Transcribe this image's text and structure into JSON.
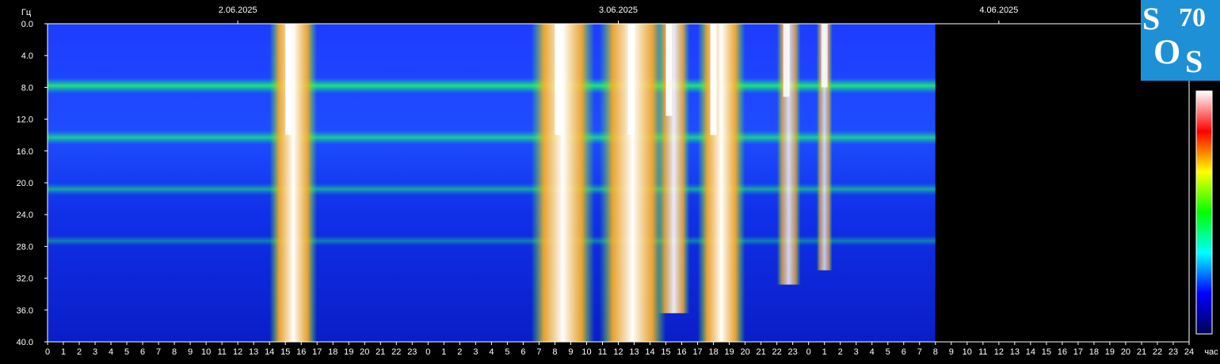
{
  "chart_data": {
    "type": "heatmap",
    "title": "",
    "ylabel": "Гц",
    "xlabel": "час",
    "ylim": [
      0,
      40
    ],
    "y_inverted": true,
    "y_ticks": [
      "0.0",
      "4.0",
      "8.0",
      "12.0",
      "16.0",
      "20.0",
      "24.0",
      "28.0",
      "32.0",
      "36.0",
      "40.0"
    ],
    "x_tick_labels": [
      "0",
      "1",
      "2",
      "3",
      "4",
      "5",
      "6",
      "7",
      "8",
      "9",
      "10",
      "11",
      "12",
      "13",
      "14",
      "15",
      "16",
      "17",
      "18",
      "19",
      "20",
      "21",
      "22",
      "23",
      "0",
      "1",
      "2",
      "3",
      "4",
      "5",
      "6",
      "7",
      "8",
      "9",
      "10",
      "11",
      "12",
      "13",
      "14",
      "15",
      "16",
      "17",
      "18",
      "19",
      "20",
      "21",
      "22",
      "23",
      "0",
      "1",
      "2",
      "3",
      "4",
      "5",
      "6",
      "7",
      "8",
      "9",
      "10",
      "11",
      "12",
      "13",
      "14",
      "15",
      "16",
      "17",
      "18",
      "19",
      "20",
      "21",
      "22",
      "23",
      "24"
    ],
    "days": [
      {
        "label": "2.06.2025",
        "start_hour": 12
      },
      {
        "label": "3.06.2025",
        "start_hour": 36
      },
      {
        "label": "4.06.2025",
        "start_hour": 60
      }
    ],
    "x_range_hours": [
      0,
      72
    ],
    "data_end_hour": 56,
    "resonance_bands_hz": [
      7.8,
      14.3,
      20.8,
      27.3
    ],
    "bursts": [
      {
        "start_hour": 14.0,
        "end_hour": 17.0,
        "peak_hour": 15.2,
        "intensity": 1.0
      },
      {
        "start_hour": 30.5,
        "end_hour": 34.5,
        "peak_hour": 32.2,
        "intensity": 1.0
      },
      {
        "start_hour": 34.8,
        "end_hour": 39.0,
        "peak_hour": 36.8,
        "intensity": 1.0
      },
      {
        "start_hour": 38.5,
        "end_hour": 40.5,
        "peak_hour": 39.2,
        "intensity": 0.8
      },
      {
        "start_hour": 41.0,
        "end_hour": 44.0,
        "peak_hour": 42.0,
        "intensity": 1.0
      },
      {
        "start_hour": 46.0,
        "end_hour": 47.5,
        "peak_hour": 46.6,
        "intensity": 0.6
      },
      {
        "start_hour": 48.5,
        "end_hour": 49.5,
        "peak_hour": 49.0,
        "intensity": 0.5
      }
    ],
    "colorbar": [
      "#000055",
      "#0000ff",
      "#00ffff",
      "#00ff00",
      "#ffff00",
      "#ff0000",
      "#ffffff"
    ]
  },
  "logo": {
    "letter1": "S",
    "letter2": "O",
    "letter3": "S",
    "number": "70"
  }
}
